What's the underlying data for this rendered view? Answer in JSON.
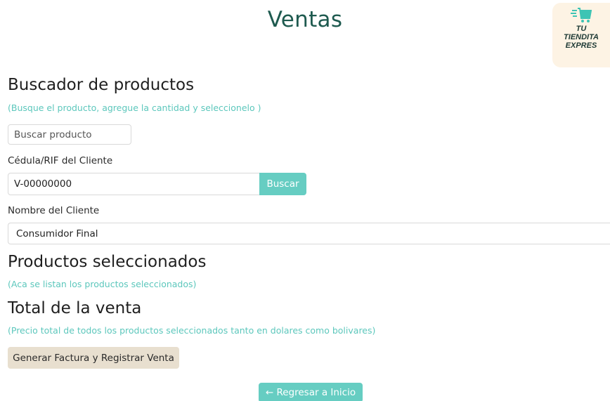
{
  "header": {
    "title": "Ventas",
    "logo_text_line1": "TU",
    "logo_text_line2": "TIENDITA",
    "logo_text_line3": "EXPRES",
    "logo_icon": "shopping-cart-icon"
  },
  "buscador": {
    "title": "Buscador de productos",
    "hint": "(Busque el producto, agregue la cantidad y seleccionelo )",
    "search_placeholder": "Buscar producto",
    "search_value": ""
  },
  "cliente": {
    "id_label": "Cédula/RIF del Cliente",
    "id_value": "V-00000000",
    "search_button": "Buscar",
    "name_label": "Nombre del Cliente",
    "name_value": "Consumidor Final"
  },
  "seleccionados": {
    "title": "Productos seleccionados",
    "hint": "(Aca se listan los productos seleccionados)"
  },
  "total": {
    "title": "Total de la venta",
    "hint": "(Precio total de todos los productos seleccionados tanto en dolares como bolivares)"
  },
  "actions": {
    "invoice_button": "Generar Factura y Registrar Venta",
    "back_button": "← Regresar a Inicio"
  },
  "colors": {
    "title": "#1e5a4f",
    "accent": "#66cdc2",
    "hint": "#5cc7bc",
    "beige_button": "#e8dfcf",
    "logo_bg": "#fdf3e4"
  }
}
